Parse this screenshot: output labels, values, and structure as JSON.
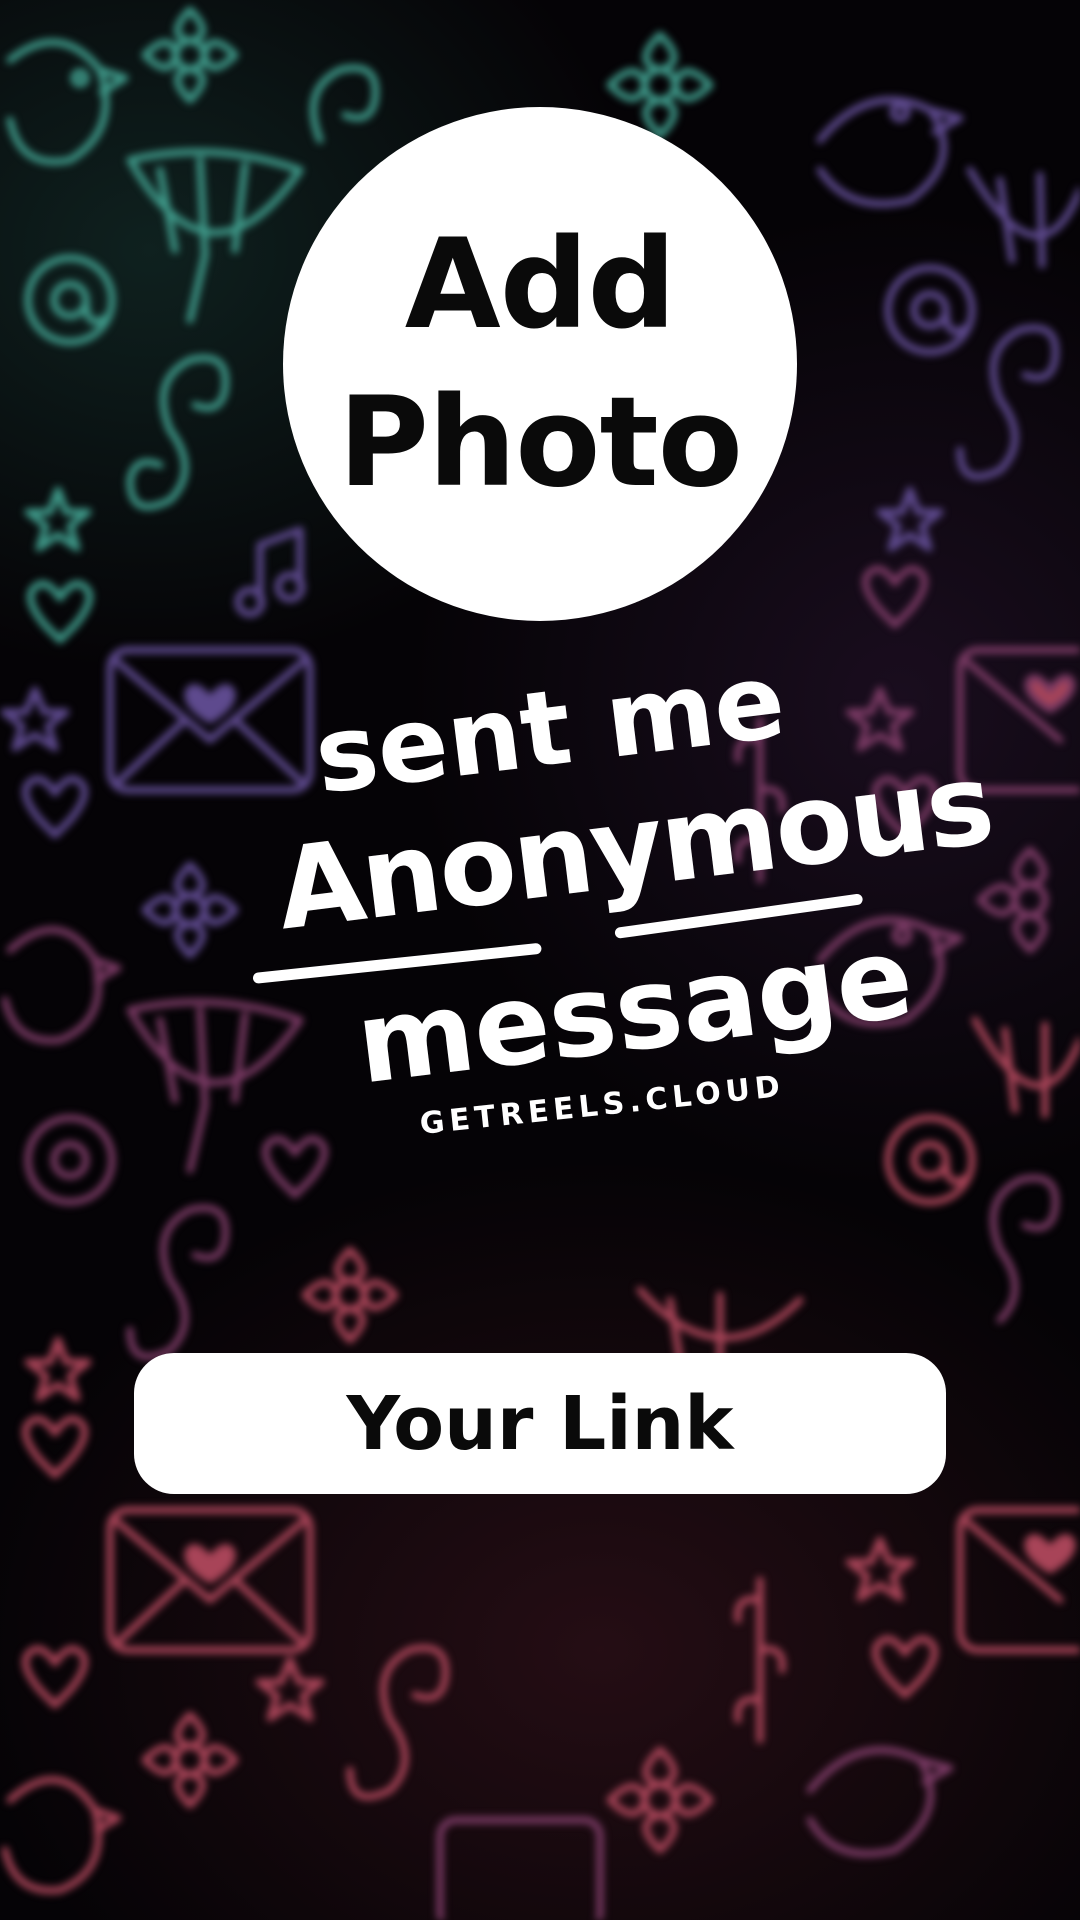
{
  "colors": {
    "background": "#050306",
    "foreground": "#ffffff",
    "text_dark": "#0a0a0a",
    "doodle_teal": "#3f9a8a",
    "doodle_purple": "#5e4a8e",
    "doodle_magenta": "#7a3a64",
    "doodle_red": "#a84458"
  },
  "photo_button": {
    "label": "Add Photo"
  },
  "headline": {
    "line1": "sent me",
    "line2": "Anonymous",
    "line3": "message"
  },
  "site": {
    "url": "GETREELS.CLOUD"
  },
  "link_button": {
    "label": "Your Link"
  },
  "background_icons": [
    "bird-icon",
    "flower-icon",
    "envelope-icon",
    "heart-icon",
    "star-icon",
    "music-note-icon",
    "at-sign-icon",
    "swirl-icon"
  ]
}
